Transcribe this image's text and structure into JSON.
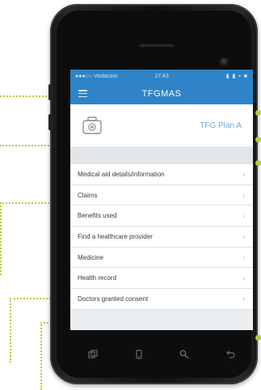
{
  "statusbar": {
    "carrier": "●●●○○ Vodacom",
    "time": "17:43",
    "indicators": "▮ ▮ ▪ ■"
  },
  "header": {
    "title": "TFGMAS",
    "menu_icon": "hamburger-menu-icon"
  },
  "plan": {
    "icon": "medical-case-icon",
    "name": "TFG Plan A"
  },
  "menu": {
    "items": [
      {
        "label": "Medical aid details/information"
      },
      {
        "label": "Claims"
      },
      {
        "label": "Benefits used"
      },
      {
        "label": "Find a healthcare provider"
      },
      {
        "label": "Medicine"
      },
      {
        "label": "Health record"
      },
      {
        "label": "Doctors granted consent"
      }
    ],
    "chevron": "›"
  },
  "hardware_buttons": [
    {
      "icon": "recent-apps-icon"
    },
    {
      "icon": "home-icon"
    },
    {
      "icon": "search-icon"
    },
    {
      "icon": "back-icon"
    }
  ],
  "colors": {
    "accent": "#2f83c7",
    "callout": "#b9c93a",
    "plan_text": "#6fa8d3"
  }
}
